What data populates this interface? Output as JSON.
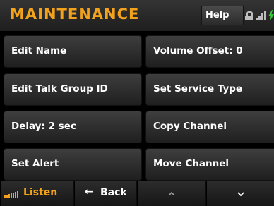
{
  "header": {
    "title": "MAINTENANCE",
    "help_label": "Help",
    "icons": [
      "lock-icon",
      "signal-icon",
      "bolt-icon"
    ]
  },
  "buttons": {
    "edit_name": "Edit Name",
    "volume_offset": "Volume Offset: 0",
    "edit_talk_group_id": "Edit Talk Group ID",
    "set_service_type": "Set Service Type",
    "delay": "Delay: 2 sec",
    "copy_channel": "Copy Channel",
    "set_alert": "Set Alert",
    "move_channel": "Move Channel"
  },
  "footer": {
    "listen_label": "Listen",
    "back_arrow": "←",
    "back_label": "Back",
    "up_icon": "chevron-up-icon",
    "down_icon": "chevron-down-icon"
  },
  "colors": {
    "accent": "#f2a21b",
    "background": "#000000",
    "button": "#2e2e2e"
  }
}
